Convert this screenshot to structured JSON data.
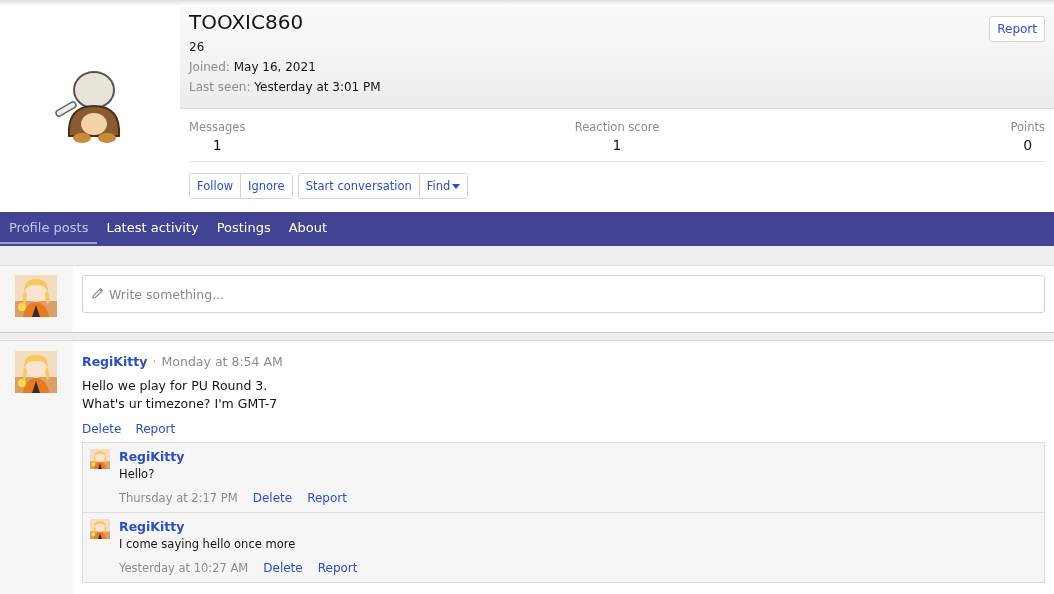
{
  "profile": {
    "username": "TOOXIC860",
    "user_title": "26",
    "joined_label": "Joined:",
    "joined": "May 16, 2021",
    "last_seen_label": "Last seen:",
    "last_seen": "Yesterday at 3:01 PM",
    "report": "Report",
    "stats": [
      {
        "label": "Messages",
        "value": "1"
      },
      {
        "label": "Reaction score",
        "value": "1"
      },
      {
        "label": "Points",
        "value": "0"
      }
    ],
    "action_groups": [
      [
        {
          "label": "Follow",
          "dropdown": false
        },
        {
          "label": "Ignore",
          "dropdown": false
        }
      ],
      [
        {
          "label": "Start conversation",
          "dropdown": false
        },
        {
          "label": "Find",
          "dropdown": true
        }
      ]
    ]
  },
  "tabs": [
    {
      "label": "Profile posts",
      "selected": true
    },
    {
      "label": "Latest activity",
      "selected": false
    },
    {
      "label": "Postings",
      "selected": false
    },
    {
      "label": "About",
      "selected": false
    }
  ],
  "composer": {
    "placeholder": "Write something..."
  },
  "posts": [
    {
      "author": "RegiKitty",
      "separator": "·",
      "time": "Monday at 8:54 AM",
      "lines": [
        "Hello we play for PU Round 3.",
        "What's ur timezone? I'm GMT-7"
      ],
      "actions": [
        "Delete",
        "Report"
      ],
      "comments": [
        {
          "author": "RegiKitty",
          "text": "Hello?",
          "time": "Thursday at 2:17 PM",
          "actions": [
            "Delete",
            "Report"
          ]
        },
        {
          "author": "RegiKitty",
          "text": "I come saying hello once more",
          "time": "Yesterday at 10:27 AM",
          "actions": [
            "Delete",
            "Report"
          ]
        }
      ]
    }
  ]
}
